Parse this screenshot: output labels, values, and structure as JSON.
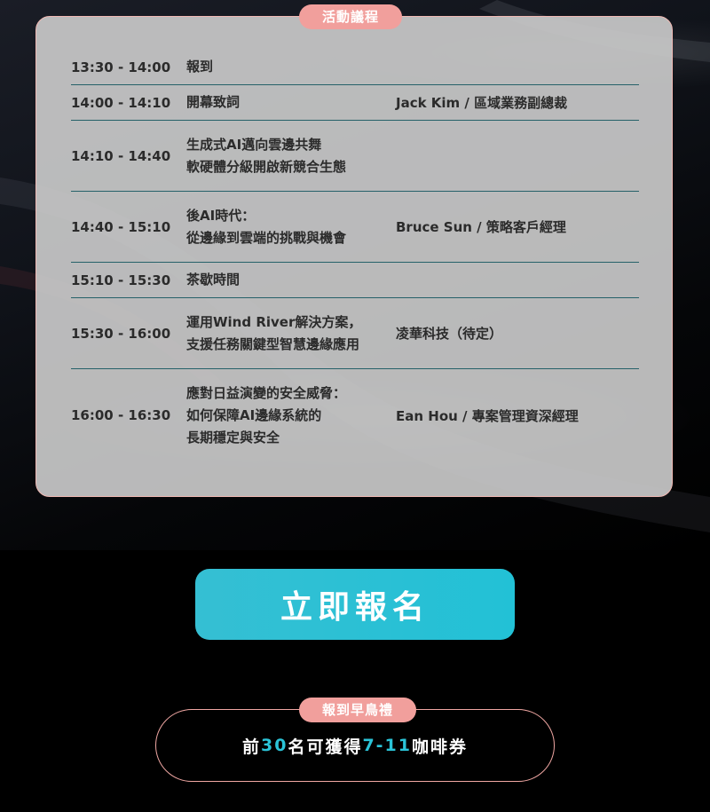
{
  "agenda": {
    "title": "活動議程",
    "rows": [
      {
        "time": "13:30 - 14:00",
        "topic": [
          "報到"
        ],
        "speaker": ""
      },
      {
        "time": "14:00 - 14:10",
        "topic": [
          "開幕致詞"
        ],
        "speaker": "Jack Kim / 區域業務副總裁"
      },
      {
        "time": "14:10 - 14:40",
        "topic": [
          "生成式AI邁向雲邊共舞",
          "軟硬體分級開啟新競合生態"
        ],
        "speaker": ""
      },
      {
        "time": "14:40 - 15:10",
        "topic": [
          "後AI時代：",
          "從邊緣到雲端的挑戰與機會"
        ],
        "speaker": "Bruce Sun / 策略客戶經理"
      },
      {
        "time": "15:10 - 15:30",
        "topic": [
          "茶歇時間"
        ],
        "speaker": ""
      },
      {
        "time": "15:30 - 16:00",
        "topic": [
          "運用Wind River解決方案，",
          "支援任務關鍵型智慧邊緣應用"
        ],
        "speaker": "凌華科技（待定）"
      },
      {
        "time": "16:00 - 16:30",
        "topic": [
          "應對日益演變的安全威脅：",
          "如何保障AI邊緣系統的",
          "長期穩定與安全"
        ],
        "speaker": "Ean Hou / 專案管理資深經理"
      }
    ]
  },
  "register": {
    "label": "立即報名"
  },
  "gift": {
    "title": "報到早鳥禮",
    "text_prefix": "前",
    "count": "30",
    "text_mid": "名可獲得",
    "item": "7-11",
    "text_suffix": "咖啡券"
  },
  "colors": {
    "accent": "#2bc4d8",
    "pill": "#f19f9c",
    "panel_border": "#efb8b3",
    "row_divider": "#256169"
  }
}
